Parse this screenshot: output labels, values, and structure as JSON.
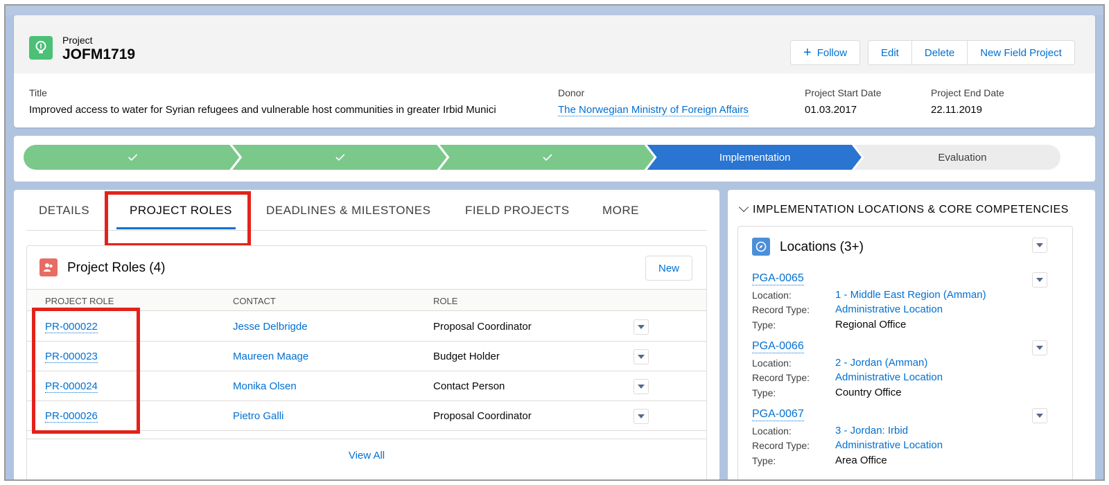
{
  "header": {
    "object_type": "Project",
    "record_name": "JOFM1719",
    "icon": "lightbulb-icon",
    "buttons": {
      "follow": "Follow",
      "edit": "Edit",
      "delete": "Delete",
      "new_field_project": "New Field Project"
    },
    "fields": {
      "title_label": "Title",
      "title_value": "Improved access to water for Syrian refugees and vulnerable host communities in greater Irbid Munici",
      "donor_label": "Donor",
      "donor_value": "The Norwegian Ministry of Foreign Affairs",
      "start_label": "Project Start Date",
      "start_value": "01.03.2017",
      "end_label": "Project End Date",
      "end_value": "22.11.2019"
    }
  },
  "path": {
    "stages": [
      {
        "label": "",
        "status": "complete"
      },
      {
        "label": "",
        "status": "complete"
      },
      {
        "label": "",
        "status": "complete"
      },
      {
        "label": "Implementation",
        "status": "current"
      },
      {
        "label": "Evaluation",
        "status": "incomplete"
      }
    ],
    "colors": {
      "complete": "#7bc88b",
      "current": "#2a74d2",
      "incomplete": "#ececec"
    }
  },
  "tabs": [
    {
      "label": "DETAILS"
    },
    {
      "label": "PROJECT ROLES"
    },
    {
      "label": "DEADLINES & MILESTONES"
    },
    {
      "label": "FIELD PROJECTS"
    },
    {
      "label": "MORE"
    }
  ],
  "project_roles": {
    "title": "Project Roles (4)",
    "new_button": "New",
    "columns": [
      "PROJECT ROLE",
      "CONTACT",
      "ROLE"
    ],
    "rows": [
      {
        "id": "PR-000022",
        "contact": "Jesse Delbrigde",
        "role": "Proposal Coordinator"
      },
      {
        "id": "PR-000023",
        "contact": "Maureen Maage",
        "role": "Budget Holder"
      },
      {
        "id": "PR-000024",
        "contact": "Monika Olsen",
        "role": "Contact Person"
      },
      {
        "id": "PR-000026",
        "contact": "Pietro Galli",
        "role": "Proposal Coordinator"
      }
    ],
    "view_all": "View All"
  },
  "side": {
    "section_title": "IMPLEMENTATION LOCATIONS & CORE COMPETENCIES",
    "locations_title": "Locations (3+)",
    "labels": {
      "location": "Location:",
      "record_type": "Record Type:",
      "type": "Type:"
    },
    "items": [
      {
        "id": "PGA-0065",
        "location": "1 - Middle East Region (Amman)",
        "record_type": "Administrative Location",
        "type": "Regional Office"
      },
      {
        "id": "PGA-0066",
        "location": "2 - Jordan (Amman)",
        "record_type": "Administrative Location",
        "type": "Country Office"
      },
      {
        "id": "PGA-0067",
        "location": "3 - Jordan: Irbid",
        "record_type": "Administrative Location",
        "type": "Area Office"
      }
    ]
  },
  "highlight_color": "#e2231a"
}
